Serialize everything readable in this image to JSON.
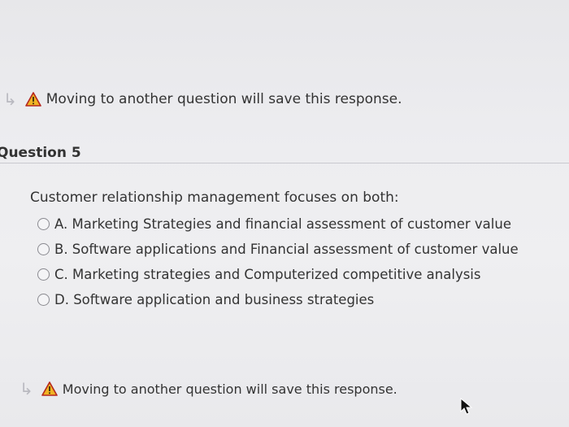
{
  "notices": {
    "top": "Moving to another question will save this response.",
    "bottom": "Moving to another question will save this response."
  },
  "question": {
    "heading": "Question 5",
    "prompt": "Customer relationship management focuses on both:",
    "options": [
      {
        "label": "A. Marketing Strategies and financial assessment of customer value"
      },
      {
        "label": "B. Software applications and Financial assessment of customer value"
      },
      {
        "label": "C. Marketing strategies and Computerized competitive analysis"
      },
      {
        "label": "D. Software application and business strategies"
      }
    ]
  },
  "icons": {
    "nav": "return-arrow-icon",
    "warning": "warning-icon"
  },
  "colors": {
    "warning_fill": "#f0b323",
    "warning_border": "#b5261e"
  }
}
